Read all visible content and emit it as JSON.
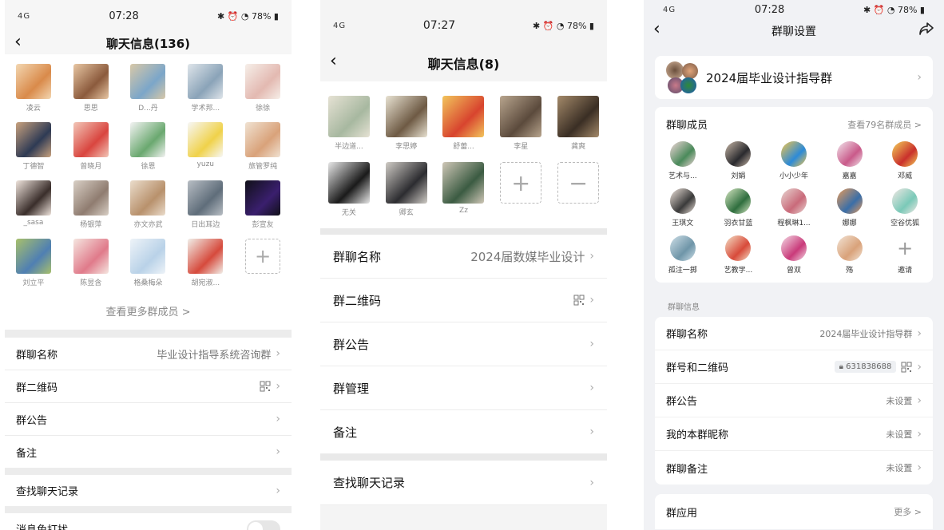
{
  "phone1": {
    "status": {
      "signal": "4G",
      "time": "07:28",
      "battery": "78%"
    },
    "title": "聊天信息(136)",
    "members": [
      {
        "name": "凌云",
        "c1": "#d98a4a",
        "c2": "#f3d7b2"
      },
      {
        "name": "思思",
        "c1": "#8b5a3c",
        "c2": "#e8c7a4"
      },
      {
        "name": "D...丹",
        "c1": "#7ba6c9",
        "c2": "#d8c8a8"
      },
      {
        "name": "学术邦...",
        "c1": "#8aa3b8",
        "c2": "#dfe5ea"
      },
      {
        "name": "徐徐",
        "c1": "#e3b9b1",
        "c2": "#f6efe9"
      },
      {
        "name": "丁德智",
        "c1": "#2e3a54",
        "c2": "#c9a27e"
      },
      {
        "name": "曾晓月",
        "c1": "#d9453f",
        "c2": "#f2c7b8"
      },
      {
        "name": "徐恩",
        "c1": "#6aa86f",
        "c2": "#f3f3f3"
      },
      {
        "name": "yuzu",
        "c1": "#f0d24a",
        "c2": "#f7f7f7"
      },
      {
        "name": "旅管罗纯",
        "c1": "#d9a27a",
        "c2": "#f0e2d2"
      },
      {
        "name": "_sasa",
        "c1": "#3a2e2b",
        "c2": "#efe4dc"
      },
      {
        "name": "杨银萍",
        "c1": "#8f7c70",
        "c2": "#d8cfc5"
      },
      {
        "name": "亦文亦武",
        "c1": "#b8916c",
        "c2": "#eadccb"
      },
      {
        "name": "日出耳边",
        "c1": "#5f6d7a",
        "c2": "#b8bec4"
      },
      {
        "name": "彭宣友",
        "c1": "#3a1f6e",
        "c2": "#101018"
      },
      {
        "name": "刘立平",
        "c1": "#4f7fb3",
        "c2": "#a8c06b"
      },
      {
        "name": "陈昱含",
        "c1": "#e07a8a",
        "c2": "#f5e6e0"
      },
      {
        "name": "格桑梅朵",
        "c1": "#b9d2e8",
        "c2": "#eef3f8"
      },
      {
        "name": "胡宛淑...",
        "c1": "#d64a3c",
        "c2": "#f1efe9"
      }
    ],
    "more_members": "查看更多群成员 >",
    "rows": [
      {
        "label": "群聊名称",
        "value": "毕业设计指导系统咨询群"
      },
      {
        "label": "群二维码",
        "value": ""
      },
      {
        "label": "群公告",
        "value": ""
      },
      {
        "label": "备注",
        "value": ""
      }
    ],
    "find_history": "查找聊天记录",
    "dnd": "消息免打扰"
  },
  "phone2": {
    "status": {
      "signal": "4G",
      "time": "07:27",
      "battery": "78%"
    },
    "title": "聊天信息(8)",
    "members": [
      {
        "name": "半边道...",
        "c1": "#a7b8a0",
        "c2": "#e6e2d4"
      },
      {
        "name": "李思婷",
        "c1": "#6e5a44",
        "c2": "#e8e2d2"
      },
      {
        "name": "舒蕾...",
        "c1": "#d8442e",
        "c2": "#f2c55c"
      },
      {
        "name": "李星",
        "c1": "#5b4a3c",
        "c2": "#b8a58e"
      },
      {
        "name": "龚爽",
        "c1": "#3a2e24",
        "c2": "#a48a6a"
      },
      {
        "name": "无关",
        "c1": "#1a1a1a",
        "c2": "#e8e8e8"
      },
      {
        "name": "卿玄",
        "c1": "#2c2c30",
        "c2": "#d0ccc6"
      },
      {
        "name": "Zz",
        "c1": "#3b5b42",
        "c2": "#cfc7b7"
      }
    ],
    "rows": [
      {
        "label": "群聊名称",
        "value": "2024届数媒毕业设计"
      },
      {
        "label": "群二维码",
        "value": ""
      },
      {
        "label": "群公告",
        "value": ""
      },
      {
        "label": "群管理",
        "value": ""
      },
      {
        "label": "备注",
        "value": ""
      }
    ],
    "find_history": "查找聊天记录"
  },
  "phone3": {
    "status": {
      "signal": "4G",
      "time": "07:28",
      "battery": "78%"
    },
    "title": "群聊设置",
    "group_name": "2024届毕业设计指导群",
    "members_title": "群聊成员",
    "members_link": "查看79名群成员 >",
    "members": [
      {
        "name": "艺术与...",
        "c1": "#4a8a5a",
        "c2": "#f2d7da"
      },
      {
        "name": "刘娟",
        "c1": "#2a2a2e",
        "c2": "#c9b8a8"
      },
      {
        "name": "小小少年",
        "c1": "#2c8ad8",
        "c2": "#f4c64a"
      },
      {
        "name": "嘉嘉",
        "c1": "#c95a8a",
        "c2": "#f2e6ec"
      },
      {
        "name": "邓威",
        "c1": "#c9302c",
        "c2": "#f4d35a"
      },
      {
        "name": "王琪文",
        "c1": "#3a3a3a",
        "c2": "#efe4dc"
      },
      {
        "name": "羽衣甘蓝",
        "c1": "#2f6e3e",
        "c2": "#d8e8c4"
      },
      {
        "name": "程枫琳1...",
        "c1": "#c96a7a",
        "c2": "#e8d6d2"
      },
      {
        "name": "娜娜",
        "c1": "#3a6ea8",
        "c2": "#e89b5a"
      },
      {
        "name": "空谷优狐",
        "c1": "#7ac9b8",
        "c2": "#f2e8e4"
      },
      {
        "name": "孤注一掷",
        "c1": "#6f95a8",
        "c2": "#cfe0e8"
      },
      {
        "name": "艺教学...",
        "c1": "#d84a3a",
        "c2": "#f4e2c8"
      },
      {
        "name": "曾双",
        "c1": "#c93a7a",
        "c2": "#f4dce6"
      },
      {
        "name": "殇",
        "c1": "#d9a27a",
        "c2": "#f2e4d6"
      }
    ],
    "invite": "邀请",
    "info_section": "群聊信息",
    "rows": [
      {
        "label": "群聊名称",
        "value": "2024届毕业设计指导群"
      },
      {
        "label": "群号和二维码",
        "value": "631838688"
      },
      {
        "label": "群公告",
        "value": "未设置"
      },
      {
        "label": "我的本群昵称",
        "value": "未设置"
      },
      {
        "label": "群聊备注",
        "value": "未设置"
      }
    ],
    "apps_title": "群应用",
    "apps_more": "更多 >"
  }
}
